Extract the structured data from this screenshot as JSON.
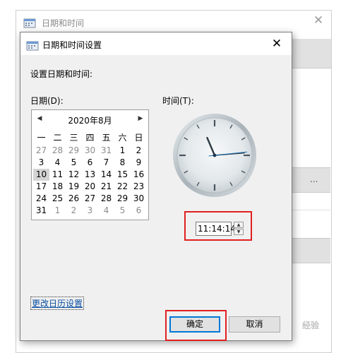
{
  "parent_window": {
    "title": "日期和时间",
    "button_partial_label": "..."
  },
  "dialog": {
    "title": "日期和时间设置",
    "instruction": "设置日期和时间:",
    "date_label": "日期(D):",
    "time_label": "时间(T):",
    "calendar": {
      "month_label": "2020年8月",
      "weekdays": [
        "一",
        "二",
        "三",
        "四",
        "五",
        "六",
        "日"
      ],
      "weeks": [
        [
          {
            "d": "27",
            "o": true
          },
          {
            "d": "28",
            "o": true
          },
          {
            "d": "29",
            "o": true
          },
          {
            "d": "30",
            "o": true
          },
          {
            "d": "31",
            "o": true
          },
          {
            "d": "1"
          },
          {
            "d": "2"
          }
        ],
        [
          {
            "d": "3"
          },
          {
            "d": "4"
          },
          {
            "d": "5"
          },
          {
            "d": "6"
          },
          {
            "d": "7"
          },
          {
            "d": "8"
          },
          {
            "d": "9"
          }
        ],
        [
          {
            "d": "10",
            "s": true
          },
          {
            "d": "11"
          },
          {
            "d": "12"
          },
          {
            "d": "13"
          },
          {
            "d": "14"
          },
          {
            "d": "15"
          },
          {
            "d": "16"
          }
        ],
        [
          {
            "d": "17"
          },
          {
            "d": "18"
          },
          {
            "d": "19"
          },
          {
            "d": "20"
          },
          {
            "d": "21"
          },
          {
            "d": "22"
          },
          {
            "d": "23"
          }
        ],
        [
          {
            "d": "24"
          },
          {
            "d": "25"
          },
          {
            "d": "26"
          },
          {
            "d": "27"
          },
          {
            "d": "28"
          },
          {
            "d": "29"
          },
          {
            "d": "30"
          }
        ],
        [
          {
            "d": "31"
          },
          {
            "d": "1",
            "o": true
          },
          {
            "d": "2",
            "o": true
          },
          {
            "d": "3",
            "o": true
          },
          {
            "d": "4",
            "o": true
          },
          {
            "d": "5",
            "o": true
          },
          {
            "d": "6",
            "o": true
          }
        ]
      ],
      "selected_day": "10"
    },
    "clock": {
      "hours": 11,
      "minutes": 14,
      "seconds": 14
    },
    "time_value": "11:14:14",
    "calendar_settings_link": "更改日历设置",
    "ok_label": "确定",
    "cancel_label": "取消"
  },
  "colors": {
    "highlight_box": "#e02020",
    "ok_button_border": "#0078d7",
    "link": "#0b4fa0",
    "selected_day_bg": "#d4d4d4"
  },
  "icons": {
    "window_icon": "date-time-settings-icon",
    "close": "close-icon",
    "prev": "chevron-left-icon",
    "next": "chevron-right-icon",
    "spin_up": "spin-up-icon",
    "spin_down": "spin-down-icon"
  },
  "watermark": "经验"
}
